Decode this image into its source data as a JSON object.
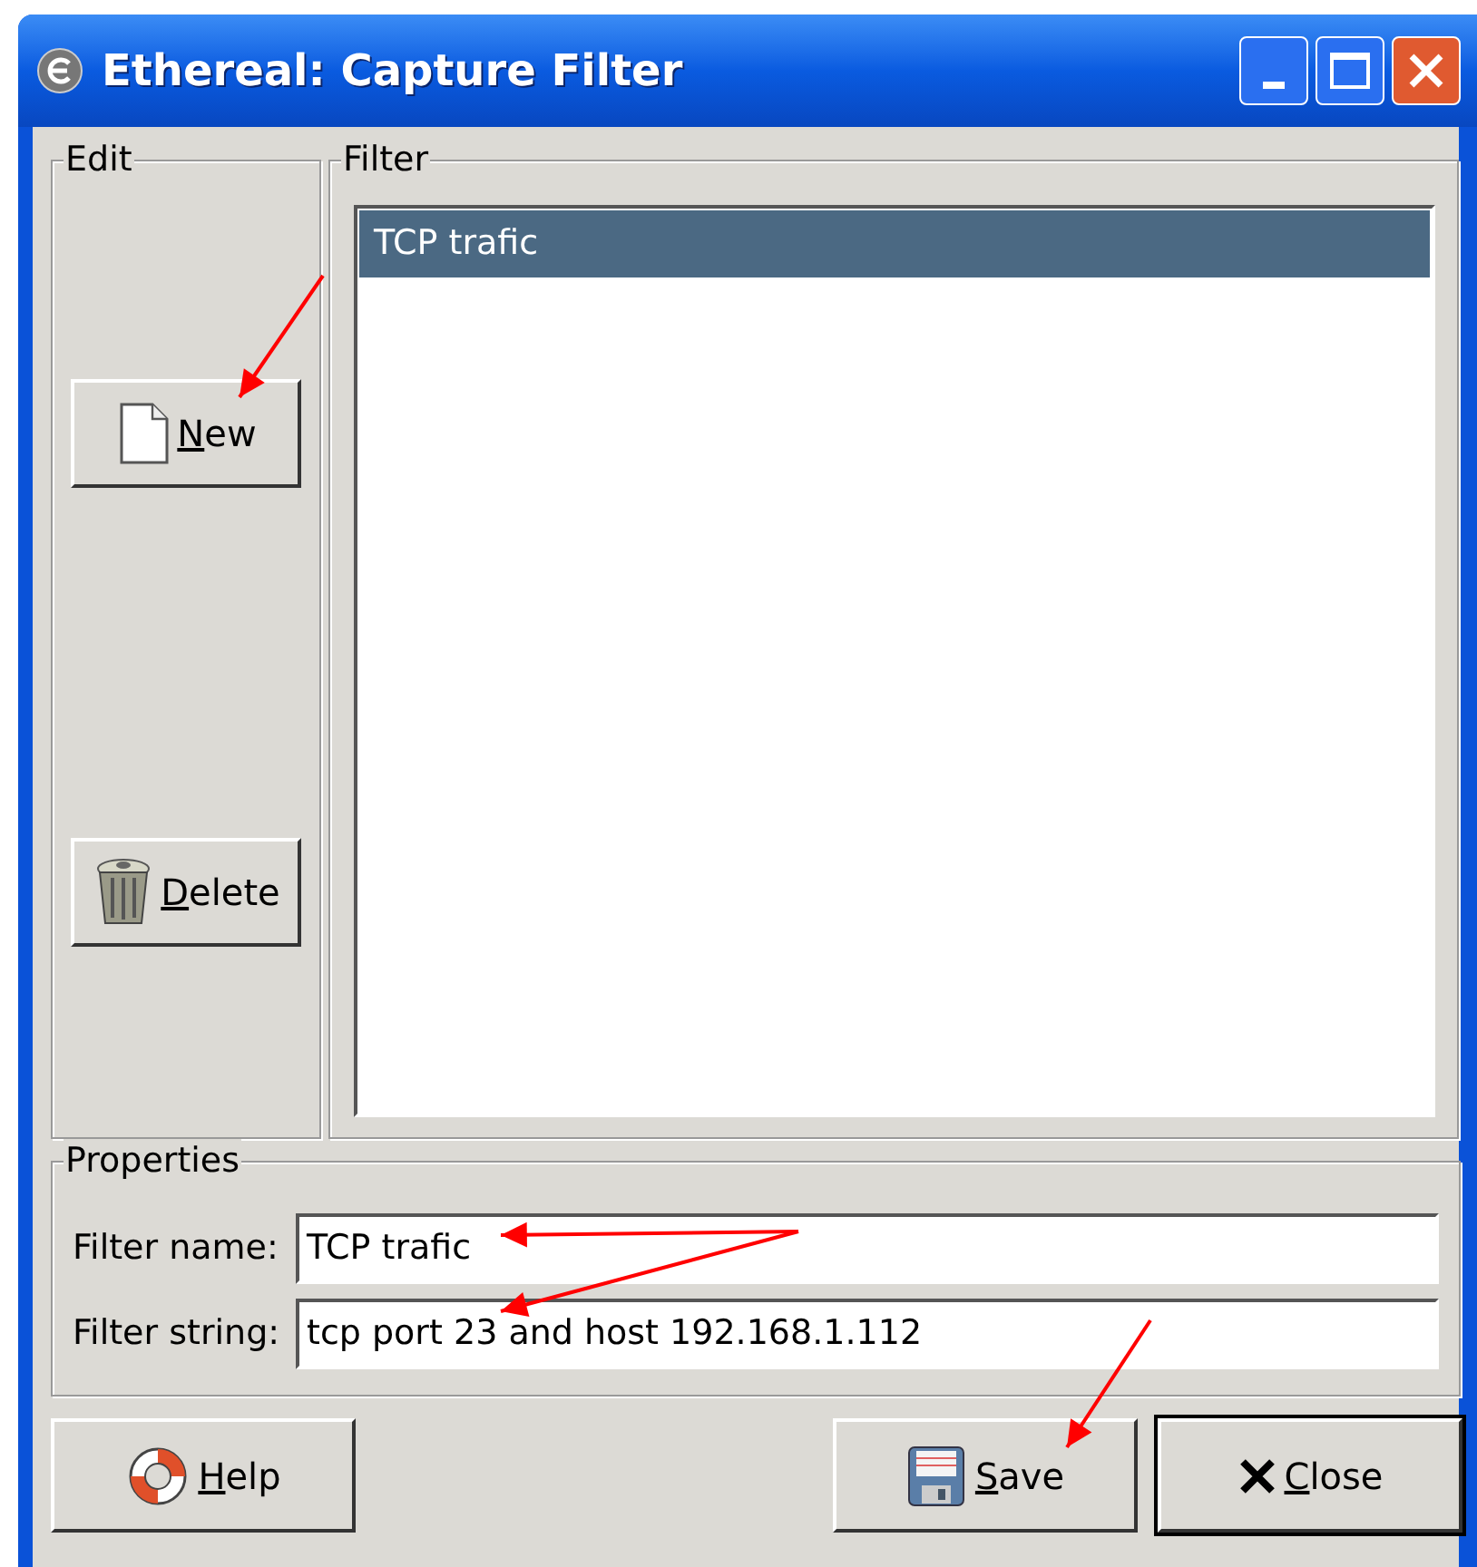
{
  "window": {
    "title": "Ethereal: Capture Filter"
  },
  "edit": {
    "legend": "Edit",
    "buttons": [
      {
        "kind": "new",
        "label": "New"
      },
      {
        "kind": "delete",
        "label": "Delete"
      }
    ]
  },
  "filter": {
    "legend": "Filter",
    "items": [
      {
        "label": "TCP trafic",
        "selected": true
      }
    ]
  },
  "properties": {
    "legend": "Properties",
    "fields": [
      {
        "label": "Filter name:",
        "value": "TCP trafic"
      },
      {
        "label": "Filter string:",
        "value": "tcp port 23 and host 192.168.1.112"
      }
    ]
  },
  "buttons": [
    {
      "kind": "help",
      "label": "Help",
      "default": false
    },
    {
      "kind": "save",
      "label": "Save",
      "default": false
    },
    {
      "kind": "close",
      "label": "Close",
      "default": true
    }
  ]
}
